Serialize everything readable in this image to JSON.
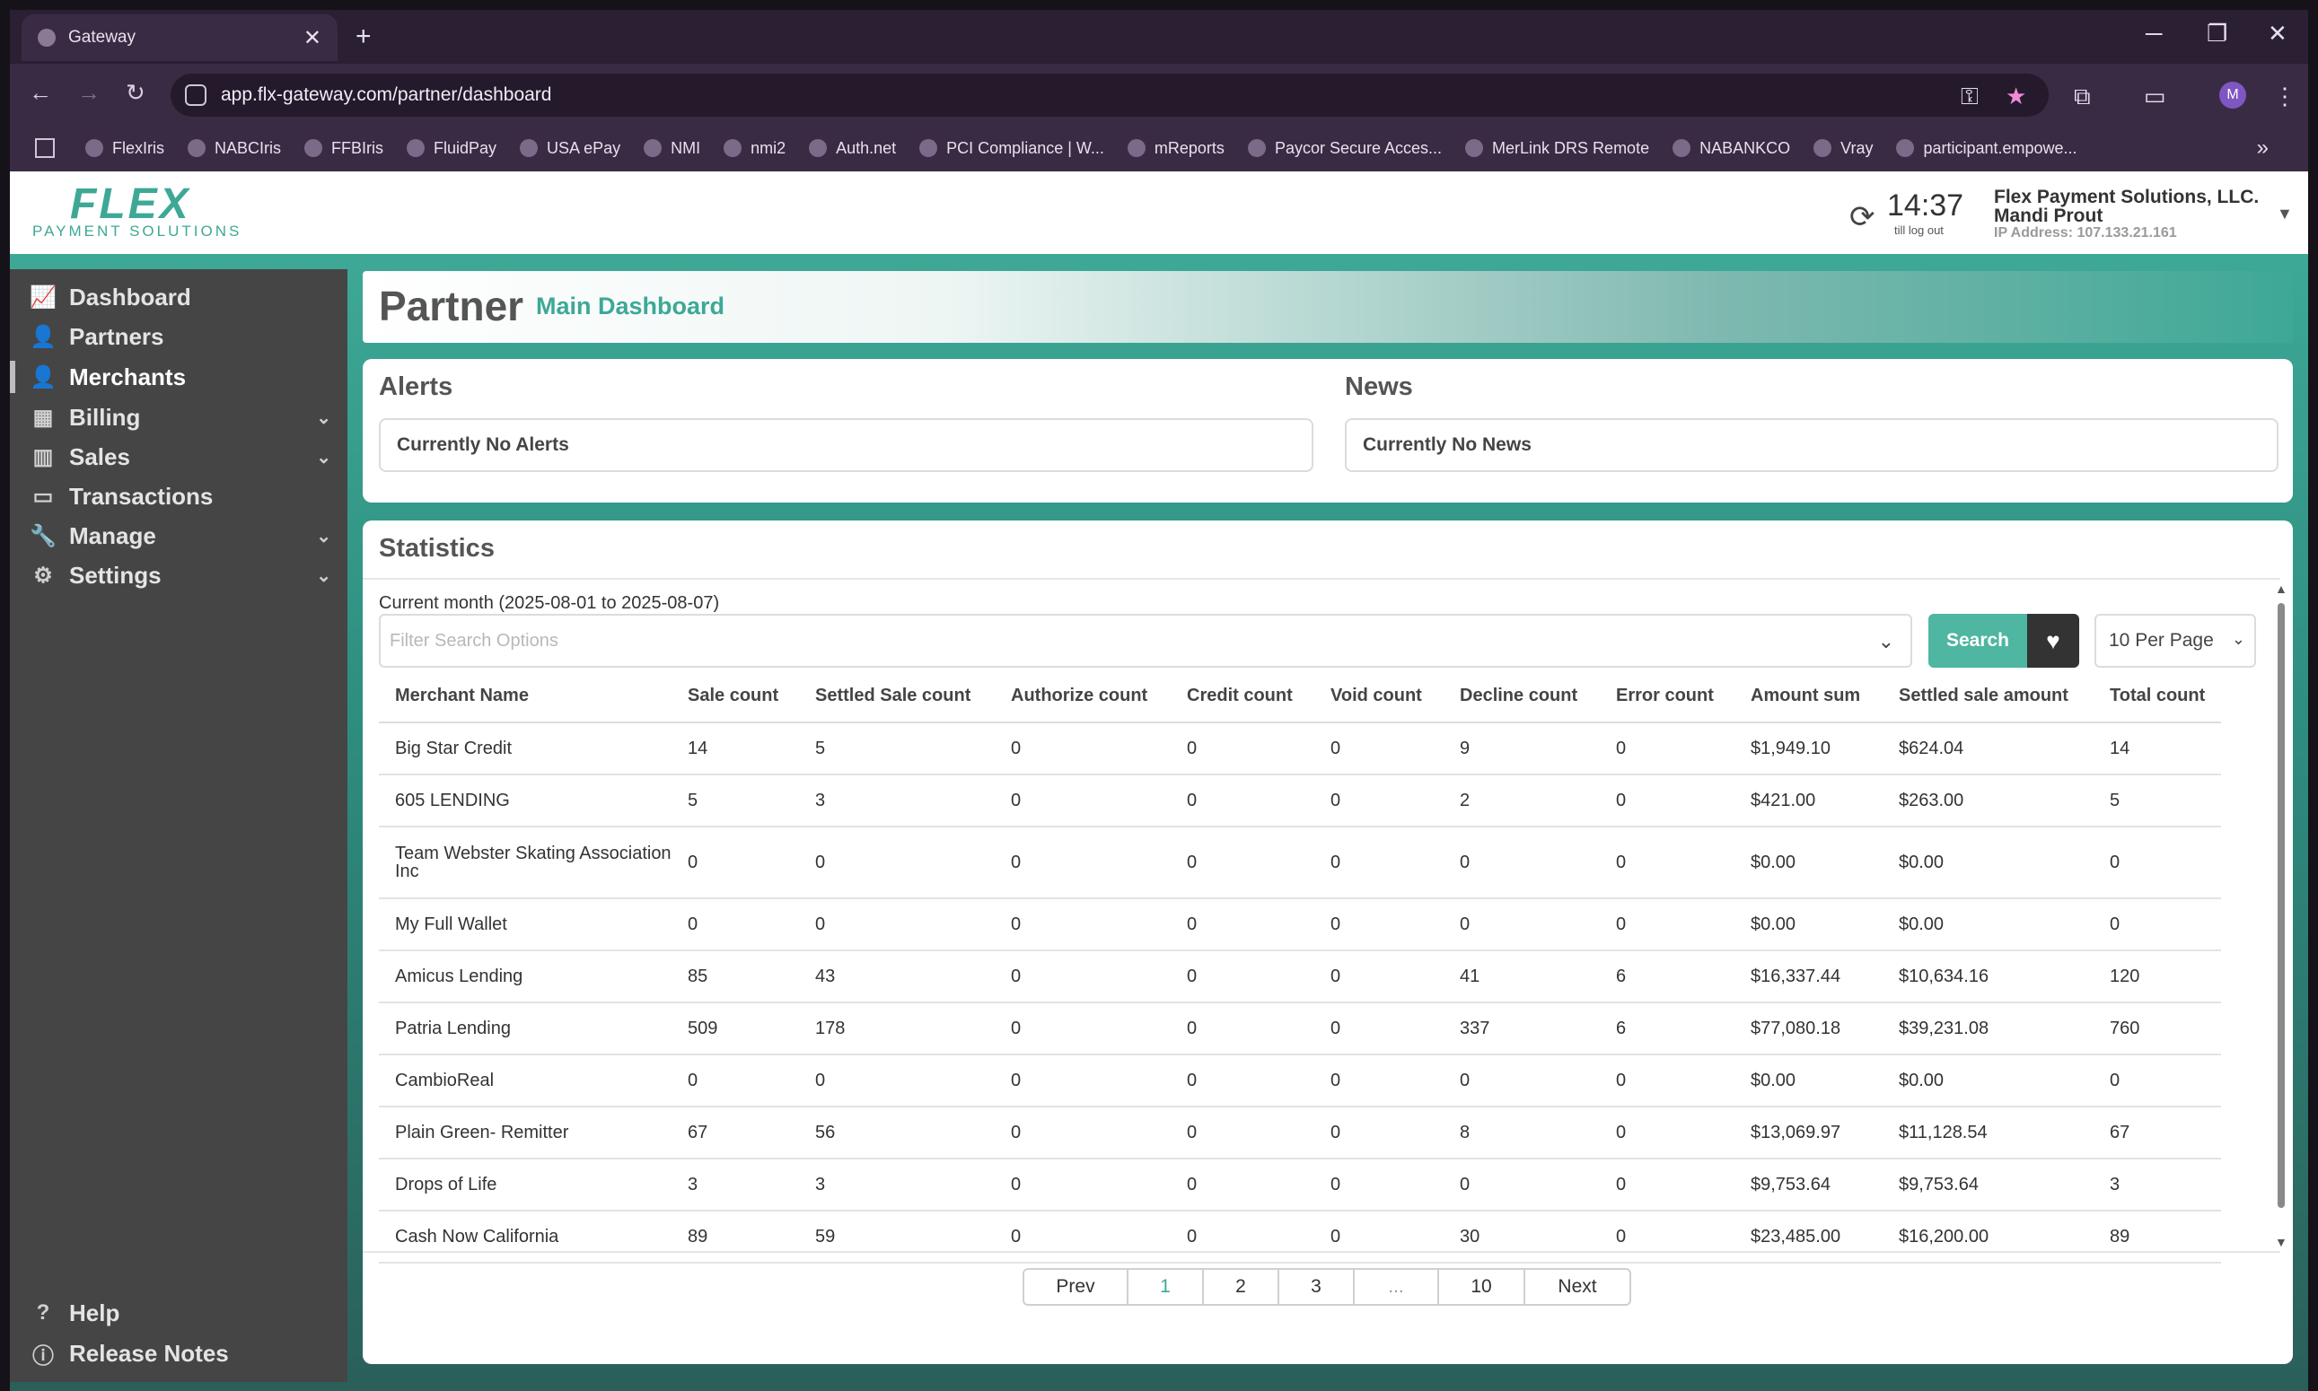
{
  "browser": {
    "tab_title": "Gateway",
    "url": "app.flx-gateway.com/partner/dashboard",
    "avatar_letter": "M",
    "bookmarks": [
      "FlexIris",
      "NABCIris",
      "FFBIris",
      "FluidPay",
      "USA ePay",
      "NMI",
      "nmi2",
      "Auth.net",
      "PCI Compliance | W...",
      "mReports",
      "Paycor Secure Acces...",
      "MerLink DRS Remote",
      "NABANKCO",
      "Vray",
      "participant.empowe..."
    ]
  },
  "header": {
    "logo": "FLEX",
    "logo_sub": "PAYMENT SOLUTIONS",
    "clock": "14:37",
    "clock_sub": "till log out",
    "org": "Flex Payment Solutions, LLC.",
    "user": "Mandi Prout",
    "ip": "IP Address: 107.133.21.161"
  },
  "sidebar": {
    "items": [
      {
        "label": "Dashboard",
        "icon": "chart-line-icon"
      },
      {
        "label": "Partners",
        "icon": "user-icon"
      },
      {
        "label": "Merchants",
        "icon": "user-icon"
      },
      {
        "label": "Billing",
        "icon": "building-icon"
      },
      {
        "label": "Sales",
        "icon": "bar-chart-icon"
      },
      {
        "label": "Transactions",
        "icon": "money-icon"
      },
      {
        "label": "Manage",
        "icon": "wrench-icon"
      },
      {
        "label": "Settings",
        "icon": "gear-icon"
      }
    ],
    "active": "Merchants",
    "footer": [
      {
        "label": "Help",
        "icon": "question-icon"
      },
      {
        "label": "Release Notes",
        "icon": "info-icon"
      }
    ]
  },
  "page": {
    "title": "Partner",
    "subtitle": "Main Dashboard"
  },
  "alerts": {
    "heading": "Alerts",
    "message": "Currently No Alerts"
  },
  "news": {
    "heading": "News",
    "message": "Currently No News"
  },
  "stats": {
    "heading": "Statistics",
    "period": "Current month (2025-08-01 to 2025-08-07)",
    "filter_placeholder": "Filter Search Options",
    "search_label": "Search",
    "per_page": "10 Per Page",
    "columns": [
      "Merchant Name",
      "Sale count",
      "Settled Sale count",
      "Authorize count",
      "Credit count",
      "Void count",
      "Decline count",
      "Error count",
      "Amount sum",
      "Settled sale amount",
      "Total count"
    ],
    "rows": [
      [
        "Big Star Credit",
        "14",
        "5",
        "0",
        "0",
        "0",
        "9",
        "0",
        "$1,949.10",
        "$624.04",
        "14"
      ],
      [
        "605 LENDING",
        "5",
        "3",
        "0",
        "0",
        "0",
        "2",
        "0",
        "$421.00",
        "$263.00",
        "5"
      ],
      [
        "Team Webster Skating Association Inc",
        "0",
        "0",
        "0",
        "0",
        "0",
        "0",
        "0",
        "$0.00",
        "$0.00",
        "0"
      ],
      [
        "My Full Wallet",
        "0",
        "0",
        "0",
        "0",
        "0",
        "0",
        "0",
        "$0.00",
        "$0.00",
        "0"
      ],
      [
        "Amicus Lending",
        "85",
        "43",
        "0",
        "0",
        "0",
        "41",
        "6",
        "$16,337.44",
        "$10,634.16",
        "120"
      ],
      [
        "Patria Lending",
        "509",
        "178",
        "0",
        "0",
        "0",
        "337",
        "6",
        "$77,080.18",
        "$39,231.08",
        "760"
      ],
      [
        "CambioReal",
        "0",
        "0",
        "0",
        "0",
        "0",
        "0",
        "0",
        "$0.00",
        "$0.00",
        "0"
      ],
      [
        "Plain Green- Remitter",
        "67",
        "56",
        "0",
        "0",
        "0",
        "8",
        "0",
        "$13,069.97",
        "$11,128.54",
        "67"
      ],
      [
        "Drops of Life",
        "3",
        "3",
        "0",
        "0",
        "0",
        "0",
        "0",
        "$9,753.64",
        "$9,753.64",
        "3"
      ],
      [
        "Cash Now California",
        "89",
        "59",
        "0",
        "0",
        "0",
        "30",
        "0",
        "$23,485.00",
        "$16,200.00",
        "89"
      ]
    ],
    "pagination": [
      "Prev",
      "1",
      "2",
      "3",
      "...",
      "10",
      "Next"
    ],
    "current_page": "1"
  }
}
